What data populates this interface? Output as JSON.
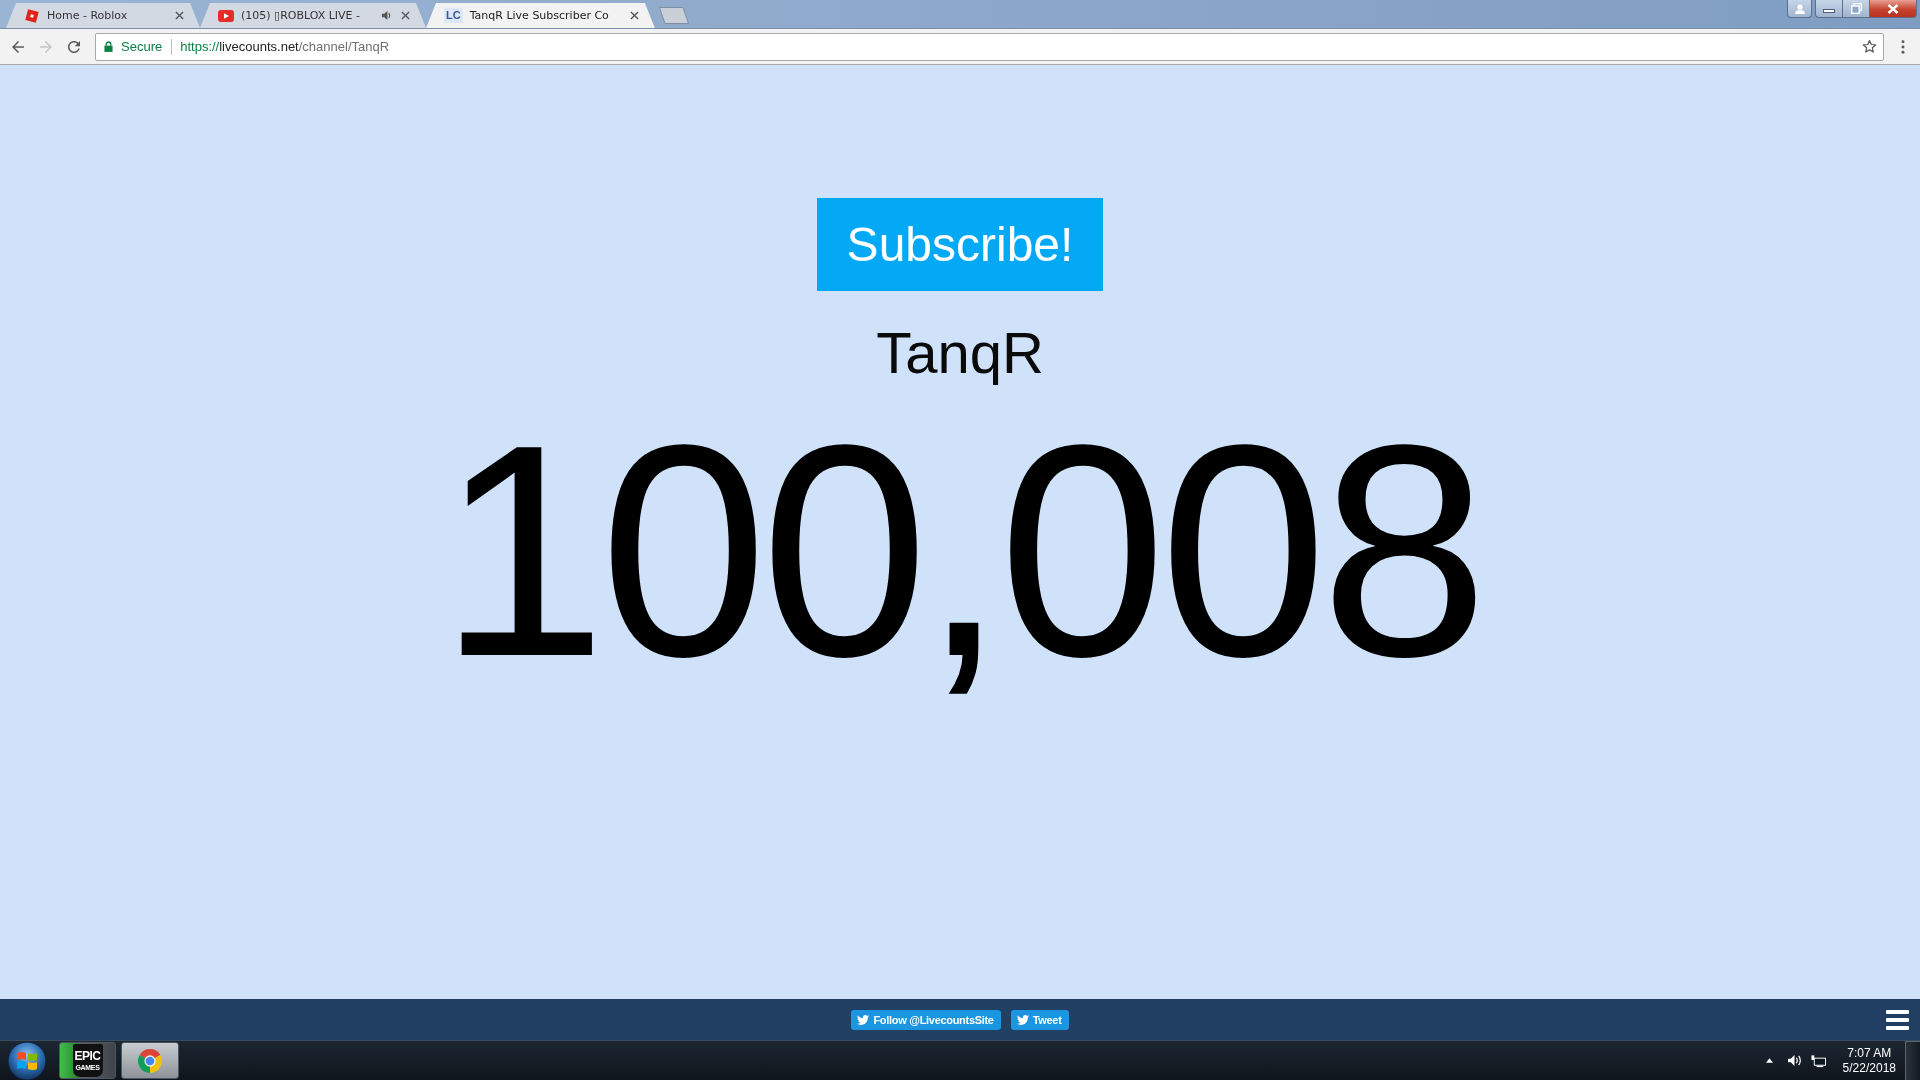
{
  "browser": {
    "tabs": [
      {
        "kind": "roblox",
        "title": "Home - Roblox",
        "selected": false,
        "audio": false
      },
      {
        "kind": "youtube",
        "title": "(105) ▯ROBLOX LIVE -",
        "selected": false,
        "audio": true
      },
      {
        "kind": "letters",
        "favicon_text": "LC",
        "title": "TanqR Live Subscriber Co",
        "selected": true,
        "audio": false
      }
    ],
    "nav": [
      {
        "kind": "back",
        "disabled": false
      },
      {
        "kind": "forward",
        "disabled": true
      },
      {
        "kind": "reload",
        "disabled": false
      }
    ],
    "address": {
      "security": "Secure",
      "scheme": "https://",
      "host": "livecounts.net",
      "path": "/channel/TanqR"
    }
  },
  "page": {
    "button": "Subscribe!",
    "channel": "TanqR",
    "count": "100,008",
    "footer": {
      "buttons": [
        "Follow @LivecountsSite",
        "Tweet"
      ]
    }
  },
  "taskbar": {
    "apps": [
      {
        "kind": "epic",
        "logo_text": [
          "EPIC",
          "GAMES"
        ]
      },
      {
        "kind": "chrome"
      }
    ],
    "clock": {
      "time": "7:07 AM",
      "date": "5/22/2018"
    }
  }
}
